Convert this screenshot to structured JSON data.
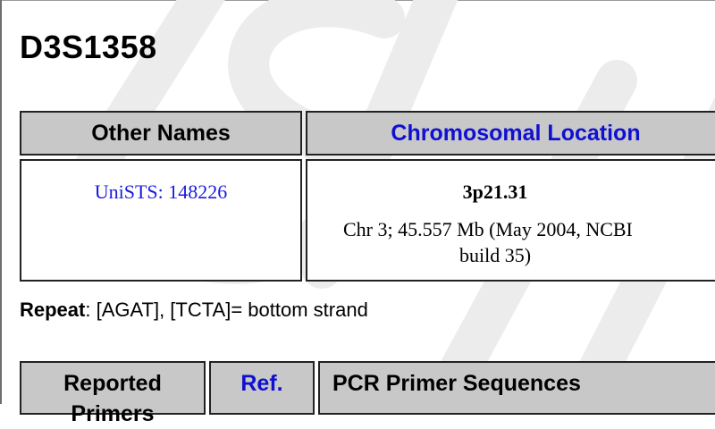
{
  "page": {
    "title": "D3S1358"
  },
  "location_table": {
    "headers": {
      "other_names": "Other Names",
      "chromosomal_location": "Chromosomal Location"
    },
    "other_names_link": "UniSTS: 148226",
    "band": "3p21.31",
    "position_line1": "Chr 3; 45.557 Mb (May 2004, NCBI",
    "position_line2": "build 35)"
  },
  "repeat": {
    "label": "Repeat",
    "value": ": [AGAT], [TCTA]= bottom strand"
  },
  "primer_table": {
    "headers": {
      "reported": "Reported",
      "reported_line2": "Primers",
      "ref": "Ref.",
      "pcr": "PCR Primer Sequences"
    }
  },
  "colors": {
    "header_bg": "#c8c8c8",
    "link_blue": "#1a1ae0",
    "border": "#222222"
  }
}
